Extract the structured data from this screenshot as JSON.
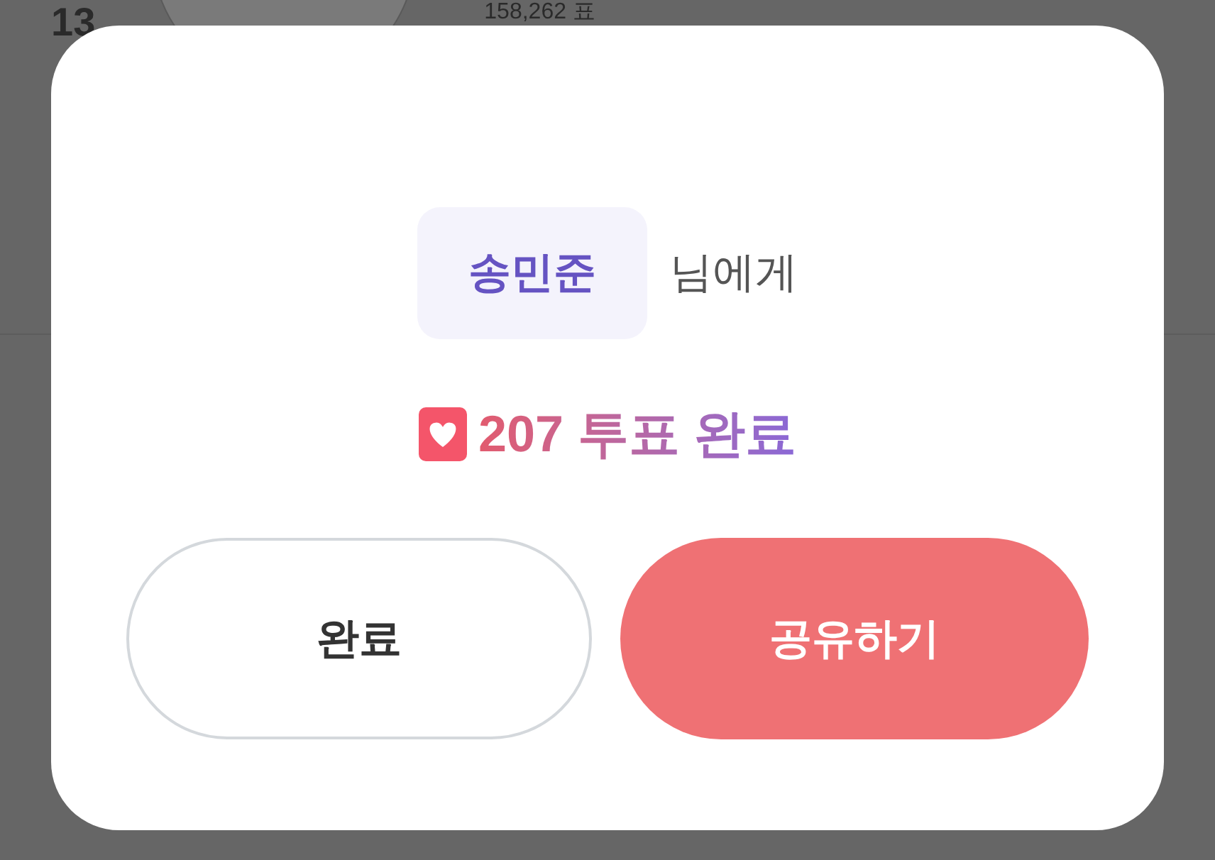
{
  "background_list": {
    "rank": "13",
    "votes": "158,262 표"
  },
  "dialog": {
    "recipient": "송민준",
    "recipient_suffix": "님에게",
    "result": "207 투표 완료",
    "buttons": [
      {
        "label": "완료",
        "kind": "secondary"
      },
      {
        "label": "공유하기",
        "kind": "primary"
      }
    ]
  }
}
